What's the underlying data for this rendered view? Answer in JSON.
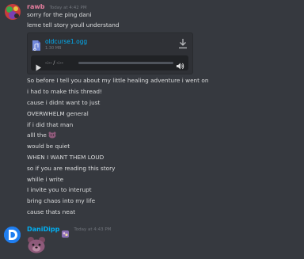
{
  "message1": {
    "username": "rawb",
    "timestamp": "Today at 4:42 PM",
    "lines": [
      "sorry for the ping dani",
      "leme tell story youll understand"
    ],
    "attachment": {
      "file_name": "oldcurse1.ogg",
      "file_size": "1.30 MB",
      "time": "-:-- / -:--",
      "progress": 0,
      "icons": [
        "audio-file-icon",
        "download-icon",
        "play-icon",
        "volume-icon"
      ]
    },
    "story_lines": [
      "So before I tell you about my little healing adventure i went on",
      "i had to make this thread!",
      "cause i didnt want to just",
      "OVERWHELM general",
      "if i did that man",
      "alll the",
      "would be quiet",
      "WHEN I WANT THEM LOUD",
      "so if you are reading this story",
      "whille i write",
      "I invite you to interupt",
      "bring chaos into my life",
      "cause thats neat"
    ]
  },
  "message2": {
    "username": "DaniDipp",
    "timestamp": "Today at 4:43 PM"
  },
  "colors": {
    "background": "#36393f",
    "username1": "#e67e9e",
    "username2": "#00b0f4",
    "link": "#00aff4",
    "text": "#dcddde"
  }
}
